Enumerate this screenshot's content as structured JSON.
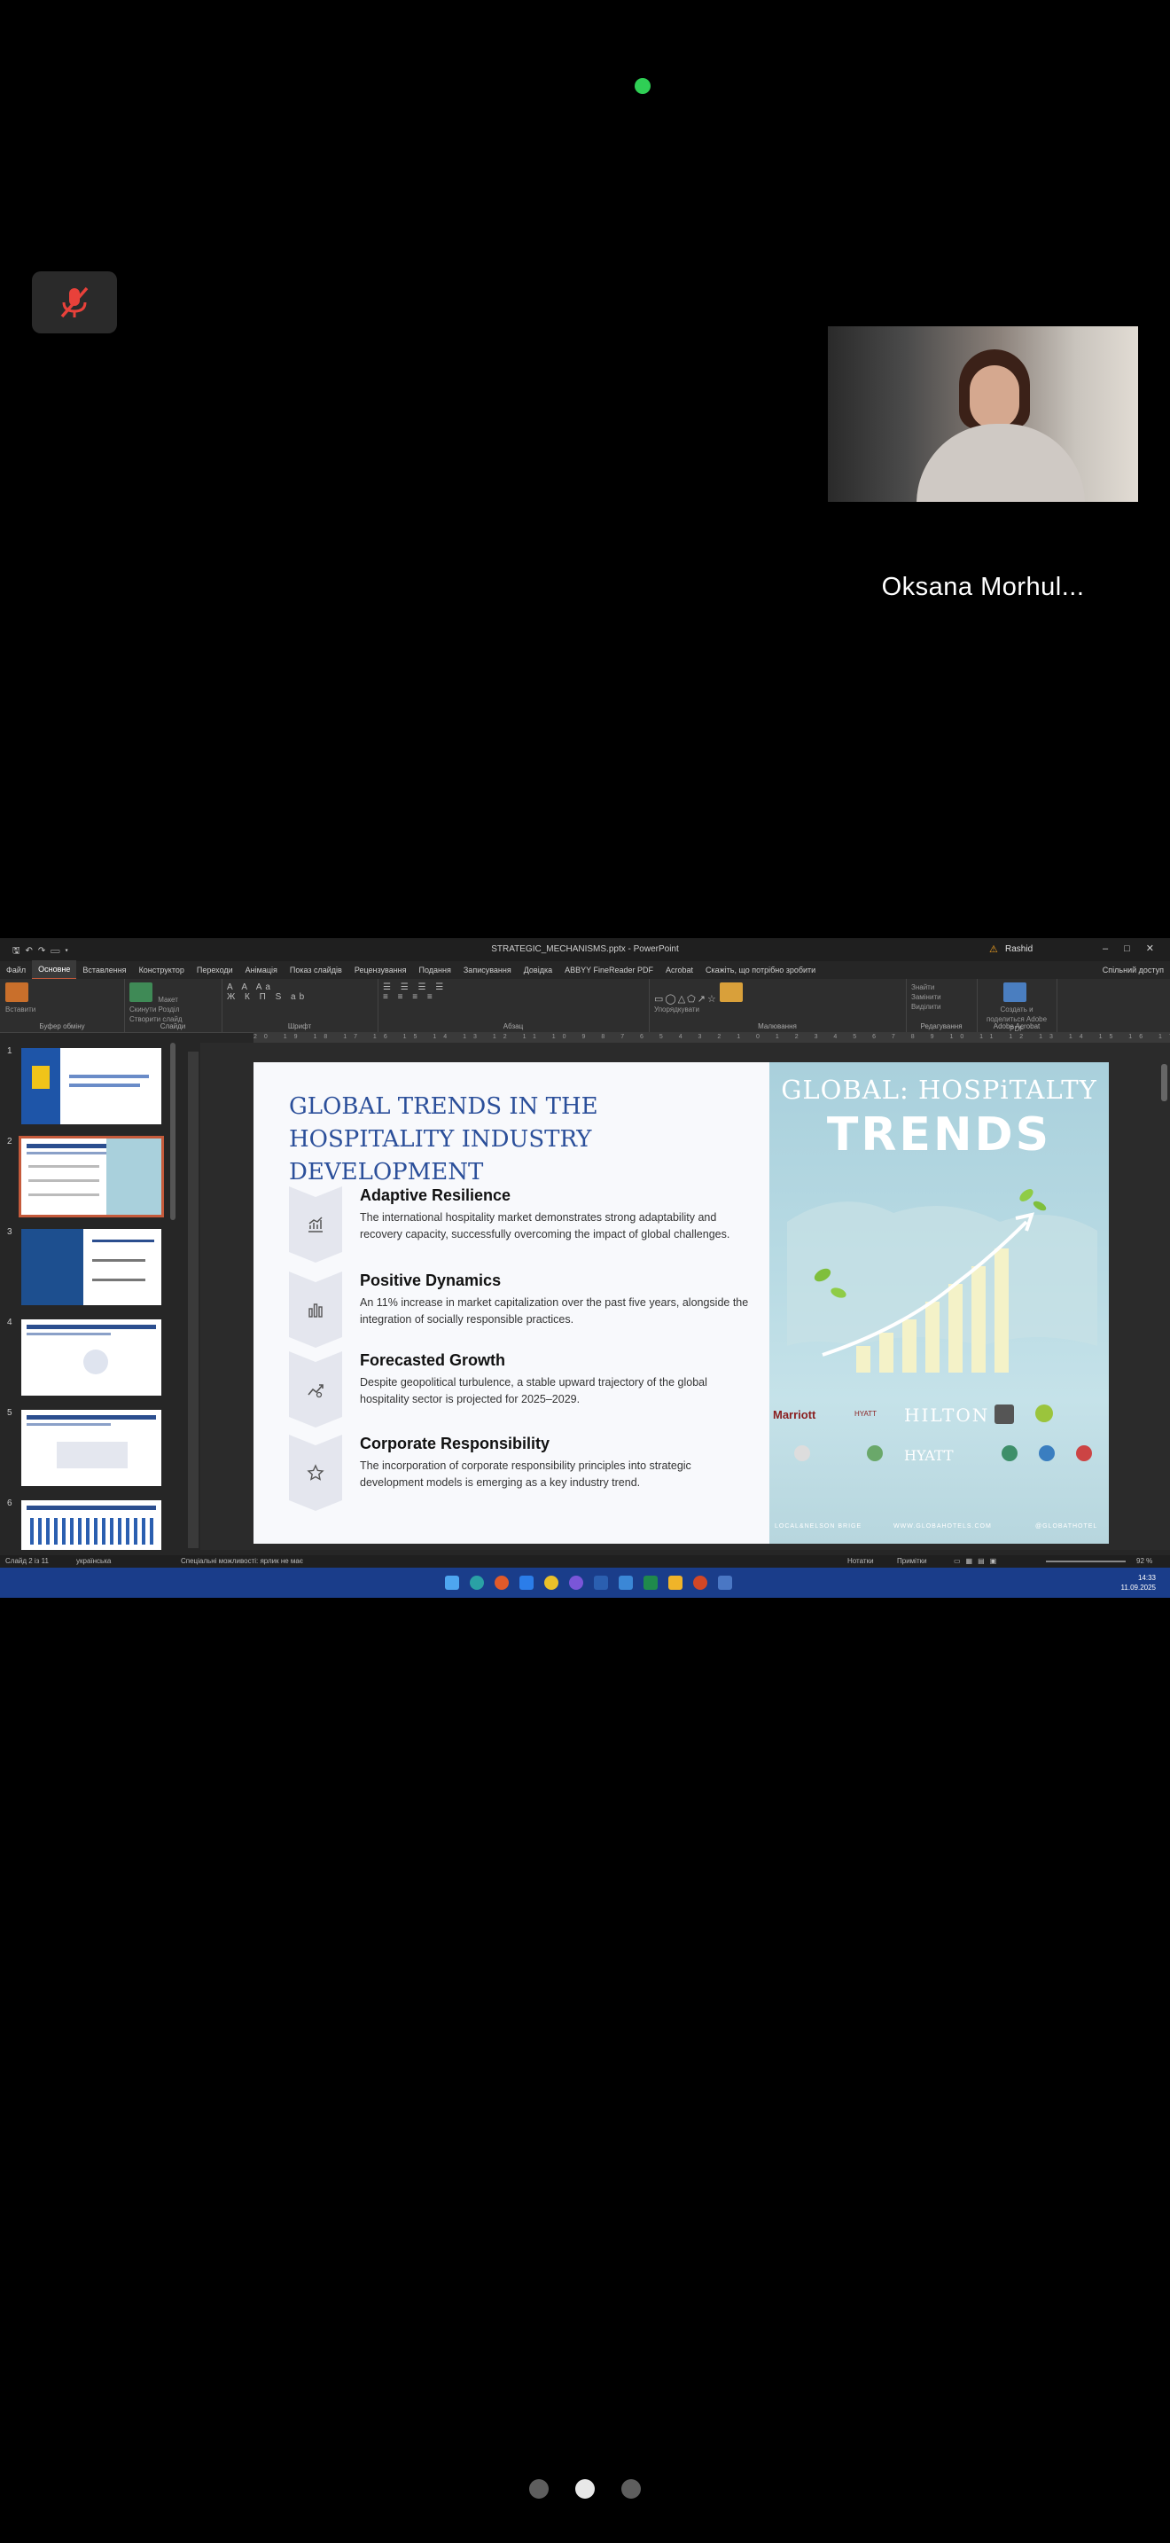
{
  "call": {
    "participant_name": "Oksana Morhul...",
    "page_indicator": {
      "count": 3,
      "active_index": 1
    }
  },
  "ppt": {
    "window_title": "STRATEGIC_MECHANISMS.pptx  -  PowerPoint",
    "user": "Rashid",
    "share_label": "Спільний доступ",
    "tabs": [
      "Файл",
      "Основне",
      "Вставлення",
      "Конструктор",
      "Переходи",
      "Анімація",
      "Показ слайдів",
      "Рецензування",
      "Подання",
      "Записування",
      "Довідка",
      "ABBYY FineReader PDF",
      "Acrobat",
      "Скажіть, що потрібно зробити"
    ],
    "active_tab": "Основне",
    "ribbon_groups": [
      {
        "label": "Буфер обміну",
        "items": [
          "Вставити"
        ]
      },
      {
        "label": "Слайди",
        "items": [
          "Макет",
          "Скинути",
          "Розділ",
          "Створити слайд"
        ]
      },
      {
        "label": "Шрифт",
        "items": []
      },
      {
        "label": "Абзац",
        "items": []
      },
      {
        "label": "Малювання",
        "items": [
          "Упорядкувати"
        ]
      },
      {
        "label": "Редагування",
        "items": [
          "Знайти",
          "Замінити",
          "Виділити"
        ]
      },
      {
        "label": "Adobe Acrobat",
        "items": [
          "Создать и поделиться Adobe PDF"
        ]
      }
    ],
    "ruler_h": "20 19 18 17 16 15 14 13 12 11 10 9 8 7 6 5 4 3 2 1 0 1 2 3 4 5 6 7 8 9 10 11 12 13 14 15 16 17 18 19 20",
    "thumbnails": [
      "1",
      "2",
      "3",
      "4",
      "5",
      "6"
    ],
    "active_thumbnail": 1,
    "status": {
      "slide": "Слайд 2 із 11",
      "language": "українська",
      "accessibility": "Спеціальні можливості: ярлик не має",
      "notes": "Нотатки",
      "comments": "Примітки",
      "zoom": "92 %"
    },
    "clock": {
      "time": "14:33",
      "date": "11.09.2025"
    }
  },
  "slide": {
    "title": "GLOBAL TRENDS IN THE HOSPITALITY INDUSTRY DEVELOPMENT",
    "points": [
      {
        "title": "Adaptive Resilience",
        "text": "The international hospitality market demonstrates strong adaptability and recovery capacity, successfully overcoming the impact of global challenges.",
        "icon": "chart-growth-icon"
      },
      {
        "title": "Positive Dynamics",
        "text": " An 11% increase in market capitalization over the past five years, alongside the integration of socially responsible practices.",
        "icon": "bar-chart-icon"
      },
      {
        "title": "Forecasted Growth",
        "text": "Despite geopolitical turbulence, a stable upward trajectory of the global hospitality sector is projected for 2025–2029.",
        "icon": "trend-up-icon"
      },
      {
        "title": "Corporate Responsibility",
        "text": " The incorporation of corporate responsibility principles into strategic development models is emerging as a key industry trend.",
        "icon": "star-icon"
      }
    ],
    "image": {
      "heading1": "GLOBAL: HOSPiTALTY",
      "heading2": "TRENDS",
      "brands_row1": [
        "Marriott",
        "HYATT",
        "HILTON"
      ],
      "brands_row2": [
        "HYATT"
      ],
      "footer_left": "LOCAL&NELSON BRIGE",
      "footer_mid": "WWW.GLOBAHOTELS.COM",
      "footer_right": "@GLOBATHOTEL"
    }
  },
  "colors": {
    "accent": "#c55a3b",
    "slide_title": "#2b4f9a",
    "taskbar": "#1a3d8a",
    "active_dot": "#2fcf55"
  }
}
